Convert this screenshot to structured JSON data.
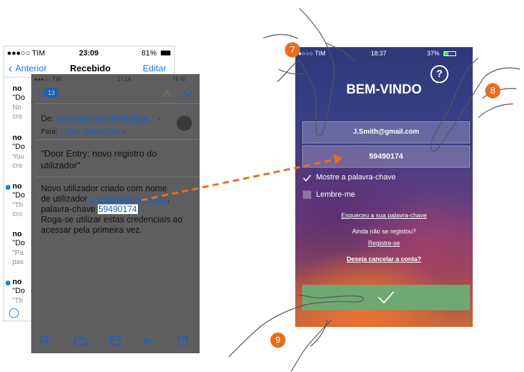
{
  "list_phone": {
    "status": {
      "carrier": "●●●○○ TIM",
      "time": "23:09",
      "battery": "81%"
    },
    "nav": {
      "back": "Anterior",
      "title": "Recebido",
      "edit": "Editar"
    },
    "items": [
      {
        "name": "no",
        "subject": "\"Do",
        "preview": [
          "Ne",
          "cro"
        ],
        "unread": false
      },
      {
        "name": "no",
        "subject": "\"Do",
        "preview": [
          "You",
          "cro"
        ],
        "unread": false
      },
      {
        "name": "no",
        "subject": "\"Do",
        "preview": [
          "\"Th",
          "cro"
        ],
        "unread": true
      },
      {
        "name": "no",
        "subject": "\"Do",
        "preview": [
          "\"Pa",
          "pas"
        ],
        "unread": false
      },
      {
        "name": "no",
        "subject": "\"Do",
        "preview": [
          "\"Th"
        ],
        "unread": true
      }
    ]
  },
  "mail_phone": {
    "status": {
      "carrier": "●●●○○ TIM",
      "time": "17:14",
      "battery": "75 %"
    },
    "badge_count": "13",
    "from_label": "De:",
    "from": "noreply@bs.eliotbylegr...",
    "to_label": "Para:",
    "to": "J.Smith@gmail.com",
    "subject": "\"Door Entry: novo registro do utilizador\"",
    "body_l1": "Novo utilizador criado com nome",
    "body_l2a": "de utilizador ",
    "body_user": "J.Smith@gmail.com",
    "body_l2b": ",",
    "body_l3a": "palavra-chave ",
    "body_pass": "59490174",
    "body_l3b": ".",
    "body_l4": "Roga-se utilizar estas credenciais ao",
    "body_l5": "acessar pela primeira vez."
  },
  "app_phone": {
    "status": {
      "carrier": "●○○○ TIM",
      "time": "18:37",
      "battery": "37%"
    },
    "help": "?",
    "title": "BEM-VINDO",
    "email": "J.Smith@gmail.com",
    "password": "59490174",
    "show_password": "Mostre a palavra-chave",
    "remember": "Lembre-me",
    "forgot": "Esqueceu a sua palavra-chave",
    "not_registered": "Ainda não se registou?",
    "register": "Registre-se",
    "cancel": "Deseja cancelar a conta?"
  },
  "steps": {
    "a": "7",
    "b": "8",
    "c": "9"
  },
  "colors": {
    "accent": "#e96d1f",
    "ios_blue": "#1e7bf2",
    "confirm": "#6fa870"
  }
}
